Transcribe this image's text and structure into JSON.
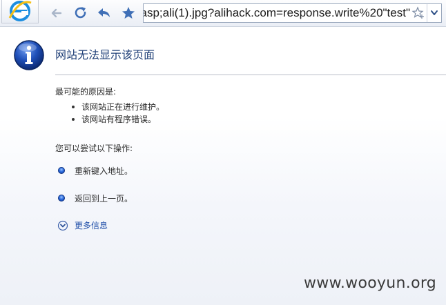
{
  "browser": {
    "address_bar": {
      "url": "asp;ali(1).jpg?alihack.com=response.write%20\"test\""
    },
    "icons": {
      "logo": "internet-explorer-logo",
      "back": "back-arrow-icon",
      "refresh": "refresh-icon",
      "home": "back-curved-arrow-icon",
      "favorites": "star-icon",
      "add_favorite": "star-outline-icon",
      "dropdown": "chevron-down-icon"
    }
  },
  "error_page": {
    "title": "网站无法显示该页面",
    "causes_heading": "最可能的原因是:",
    "causes": [
      "该网站正在进行维护。",
      "该网站有程序错误。"
    ],
    "actions_heading": "您可以尝试以下操作:",
    "actions": [
      "重新键入地址。",
      "返回到上一页。"
    ],
    "more_info": "更多信息"
  },
  "watermark": "www.wooyun.org",
  "colors": {
    "title": "#1f3f77",
    "link": "#1f4ea8",
    "info_icon": "#1b3f9c",
    "toolbar_icons": "#3f6fb6"
  }
}
